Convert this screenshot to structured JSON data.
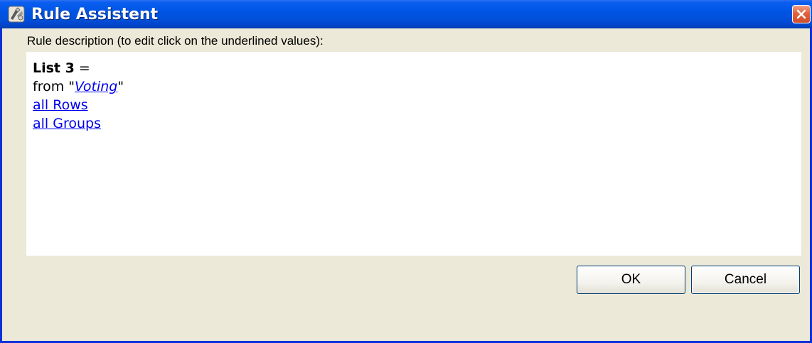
{
  "window": {
    "title": "Rule Assistent"
  },
  "description_label": "Rule description (to edit click on the underlined values):",
  "rule": {
    "title": "List 3",
    "equals": " =",
    "from_prefix": "from \"",
    "from_value": "Voting",
    "from_suffix": "\"",
    "rows_link": "all Rows",
    "groups_link": "all Groups"
  },
  "buttons": {
    "ok_label": "OK",
    "cancel_label": "Cancel"
  },
  "icons": {
    "title_icon": "rule-assistant-icon",
    "close_icon": "close-icon"
  },
  "colors": {
    "titlebar": "#0055e5",
    "link": "#0000ee",
    "dialog_bg": "#ece9d8",
    "close_button": "#d24e2a"
  }
}
